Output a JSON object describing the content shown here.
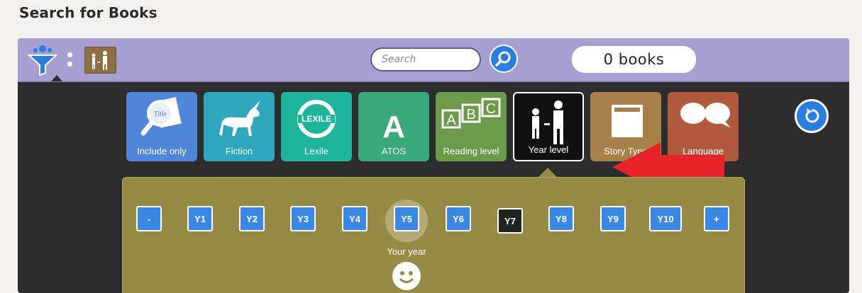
{
  "page": {
    "title": "Search for Books"
  },
  "topbar": {
    "search_placeholder": "Search",
    "book_count": "0 books"
  },
  "filters": [
    {
      "label": "Include only",
      "color": "#4f86d9"
    },
    {
      "label": "Fiction",
      "color": "#2fa8bd"
    },
    {
      "label": "Lexile",
      "color": "#1fb59c"
    },
    {
      "label": "ATOS",
      "color": "#3aa87d"
    },
    {
      "label": "Reading level",
      "color": "#6a9a4a"
    },
    {
      "label": "Year level",
      "color": "#111111"
    },
    {
      "label": "Story Type",
      "color": "#a9804a"
    },
    {
      "label": "Language",
      "color": "#b25a3e"
    }
  ],
  "year_levels": {
    "decrement_label": "-",
    "increment_label": "+",
    "items": [
      "Y1",
      "Y2",
      "Y3",
      "Y4",
      "Y5",
      "Y6",
      "Y7",
      "Y8",
      "Y9",
      "Y10"
    ],
    "selected": "Y7",
    "highlighted": "Y5",
    "your_year_label": "Your year"
  },
  "colors": {
    "topbar": "#a79fd2",
    "panel_bg": "#2d2d2d",
    "year_panel": "#978a44",
    "button_blue": "#3a87e5",
    "arrow_red": "#e8232a"
  }
}
